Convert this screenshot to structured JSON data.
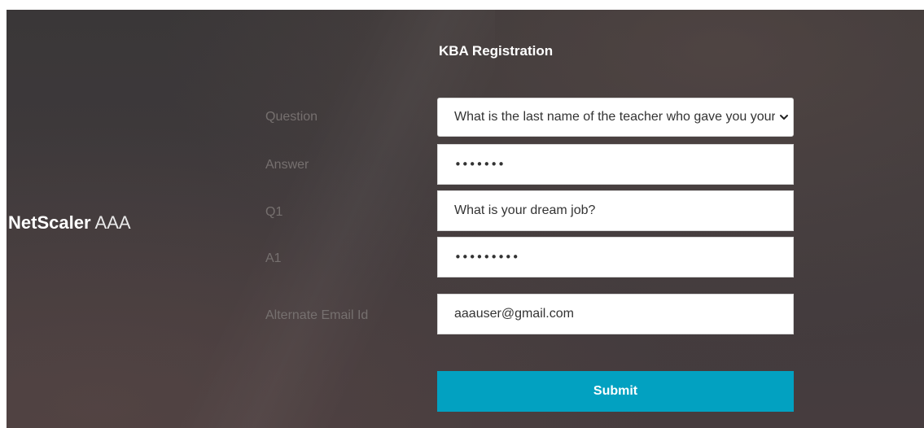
{
  "brand": {
    "name_bold": "NetScaler",
    "name_light": "AAA"
  },
  "form": {
    "title": "KBA Registration",
    "fields": [
      {
        "label": "Question",
        "value": "What is the last name of the teacher who gave you your first failing grade?",
        "type": "select"
      },
      {
        "label": "Answer",
        "value": "•••••••",
        "type": "password"
      },
      {
        "label": "Q1",
        "value": "What is your dream job?",
        "type": "text"
      },
      {
        "label": "A1",
        "value": "•••••••••",
        "type": "password"
      },
      {
        "label": "Alternate Email Id",
        "value": "aaauser@gmail.com",
        "type": "text"
      }
    ],
    "submit_label": "Submit"
  },
  "icons": {
    "dropdown": "chevron-down-icon"
  },
  "colors": {
    "submit_bg": "#02a1c1",
    "label": "#76706f",
    "background": "#3f3a3c"
  }
}
